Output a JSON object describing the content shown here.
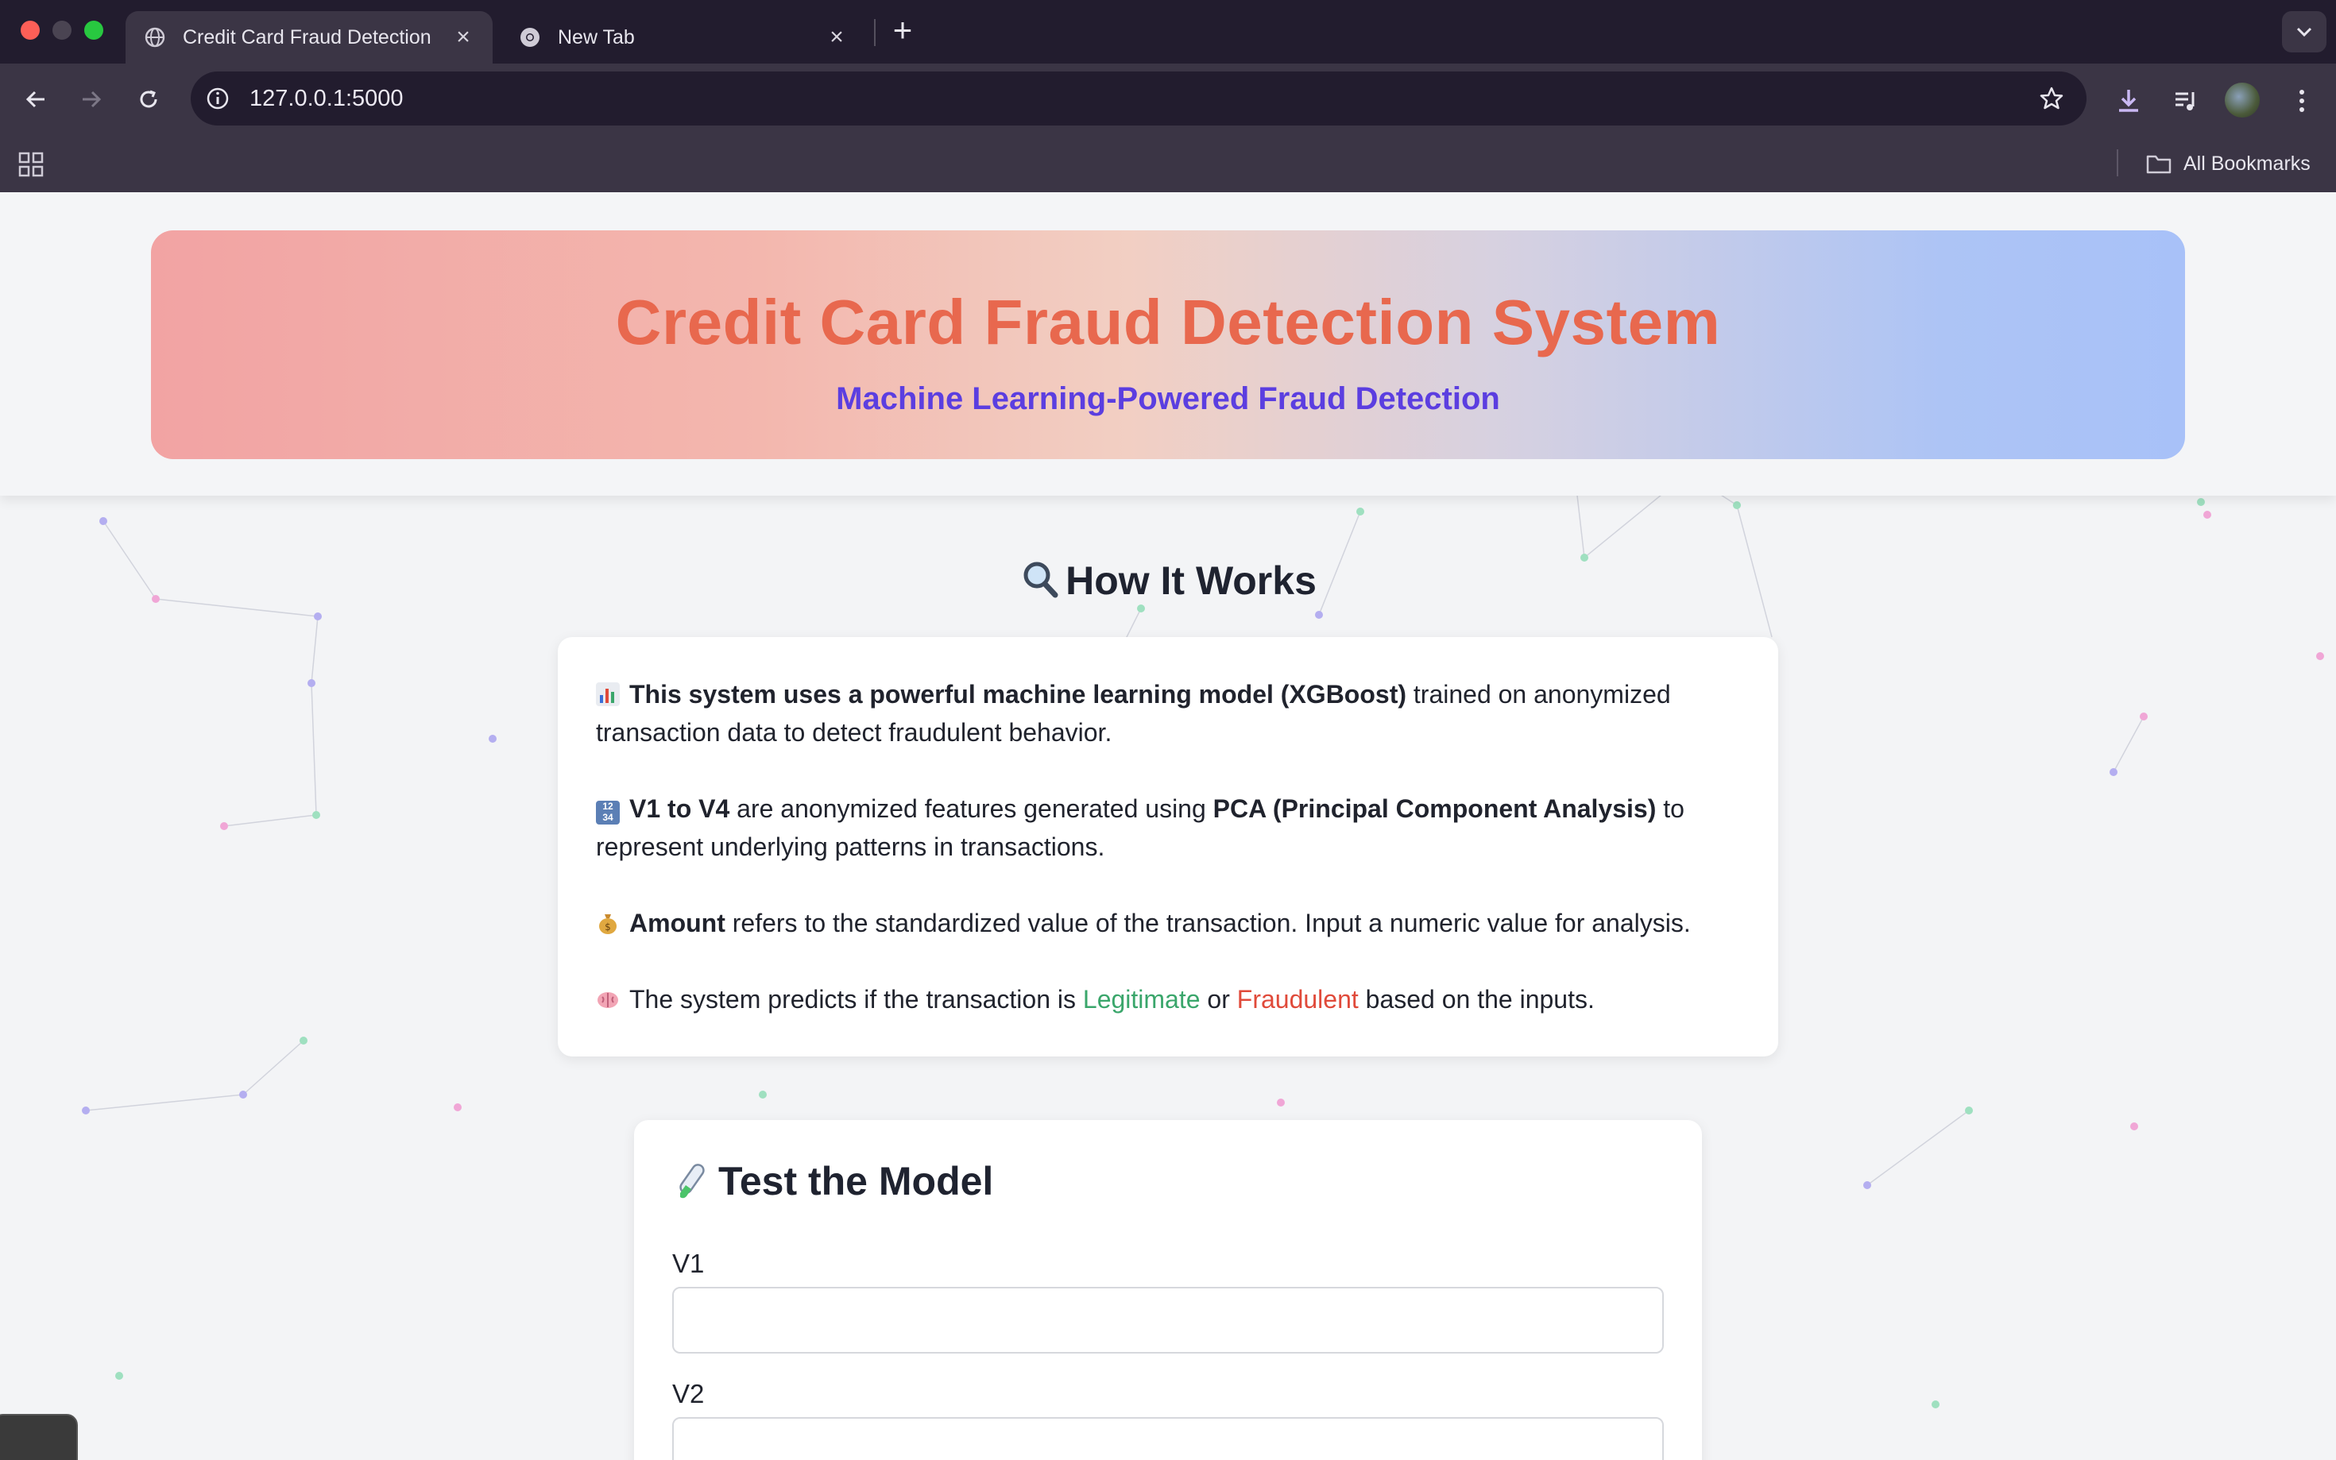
{
  "browser": {
    "tabs": [
      {
        "title": "Credit Card Fraud Detection",
        "active": true
      },
      {
        "title": "New Tab",
        "active": false
      }
    ],
    "url": "127.0.0.1:5000",
    "bookmarks_label": "All Bookmarks"
  },
  "header": {
    "title": "Credit Card Fraud Detection System",
    "subtitle": "Machine Learning-Powered Fraud Detection"
  },
  "how_it_works": {
    "heading": "How It Works",
    "p1": {
      "bold": "This system uses a powerful machine learning model (XGBoost)",
      "rest": " trained on anonymized transaction data to detect fraudulent behavior."
    },
    "p2": {
      "bold1": "V1 to V4",
      "mid": " are anonymized features generated using ",
      "bold2": "PCA (Principal Component Analysis)",
      "rest": " to represent underlying patterns in transactions."
    },
    "p3": {
      "bold": "Amount",
      "rest": " refers to the standardized value of the transaction. Input a numeric value for analysis."
    },
    "p4": {
      "pre": "The system predicts if the transaction is ",
      "legit": "Legitimate",
      "or": " or ",
      "fraud": "Fraudulent",
      "rest": " based on the inputs."
    }
  },
  "test_model": {
    "heading": "Test the Model",
    "fields": [
      {
        "label": "V1",
        "value": ""
      },
      {
        "label": "V2",
        "value": ""
      }
    ]
  },
  "colors": {
    "title": "#e8684e",
    "subtitle": "#5b3ee0",
    "legitimate": "#3aa66b",
    "fraudulent": "#e04a3a"
  },
  "icons": [
    "globe-icon",
    "chrome-icon",
    "close-icon",
    "plus-icon",
    "back-icon",
    "forward-icon",
    "reload-icon",
    "info-icon",
    "star-icon",
    "download-icon",
    "media-icon",
    "menu-icon",
    "apps-icon",
    "folder-icon",
    "magnifier-icon",
    "bar-chart-icon",
    "numbers-icon",
    "money-bag-icon",
    "brain-icon",
    "test-tube-icon"
  ]
}
